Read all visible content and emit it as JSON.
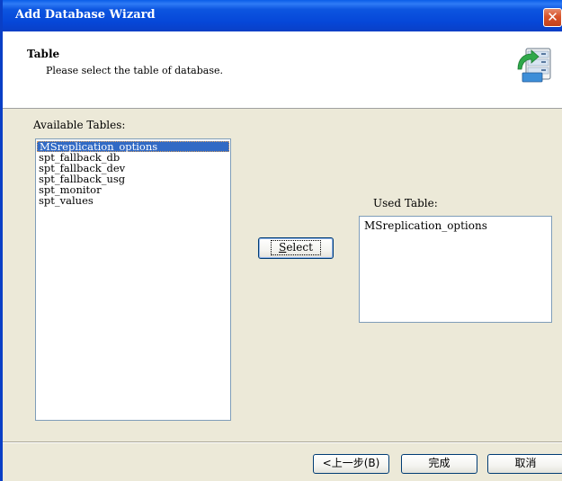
{
  "window": {
    "title": "Add Database Wizard",
    "close_glyph": "✕"
  },
  "header": {
    "title": "Table",
    "description": "Please select the table of database.",
    "icon": "database-wizard-icon"
  },
  "available": {
    "label": "Available Tables:",
    "items": [
      "MSreplication_options",
      "spt_fallback_db",
      "spt_fallback_dev",
      "spt_fallback_usg",
      "spt_monitor",
      "spt_values"
    ],
    "selected_index": 0
  },
  "select_button": {
    "label": "Select",
    "mnemonic": "S"
  },
  "used": {
    "label": "Used Table:",
    "items": [
      "MSreplication_options"
    ]
  },
  "footer": {
    "back_label": "<上一步(B)",
    "finish_label": "完成",
    "cancel_label": "取消"
  },
  "colors": {
    "titlebar": "#0a4fd8",
    "selection": "#316ac5",
    "window_bg": "#ece9d8"
  }
}
